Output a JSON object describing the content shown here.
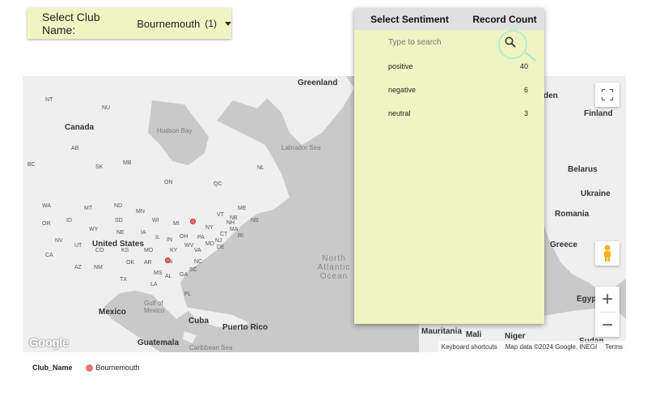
{
  "club_select": {
    "label": "Select Club Name:",
    "value": "Bournemouth",
    "count": "(1)"
  },
  "sentiment_panel": {
    "col_sentiment": "Select Sentiment",
    "col_count": "Record Count",
    "search_placeholder": "Type to search",
    "rows": [
      {
        "sentiment": "positive",
        "count": "40"
      },
      {
        "sentiment": "negative",
        "count": "6"
      },
      {
        "sentiment": "neutral",
        "count": "3"
      }
    ]
  },
  "map": {
    "labels": {
      "greenland": "Greenland",
      "canada": "Canada",
      "hudson_bay": "Hudson Bay",
      "labrador_sea": "Labrador Sea",
      "united_states": "United States",
      "mexico": "Mexico",
      "cuba": "Cuba",
      "puerto_rico": "Puerto Rico",
      "guatemala": "Guatemala",
      "gulf_of_mexico": "Gulf of Mexico",
      "caribbean_sea": "Caribbean Sea",
      "north_atlantic_ocean": "North Atlantic Ocean",
      "finland": "Finland",
      "belarus": "Belarus",
      "ukraine": "Ukraine",
      "romania": "Romania",
      "greece": "Greece",
      "egypt": "Egyp",
      "sudan": "Sudan",
      "mauritania": "Mauritania",
      "mali": "Mali",
      "niger": "Niger",
      "den": "den",
      "nt": "NT",
      "nu": "NU",
      "bc": "BC",
      "ab": "AB",
      "sk": "SK",
      "mb": "MB",
      "on": "ON",
      "qc": "QC",
      "nl": "NL",
      "wa": "WA",
      "mt": "MT",
      "nd": "ND",
      "mn": "MN",
      "or": "OR",
      "id": "ID",
      "wy": "WY",
      "sd": "SD",
      "wi": "WI",
      "mi": "MI",
      "ne": "NE",
      "ia": "IA",
      "nv": "NV",
      "ut": "UT",
      "co": "CO",
      "ks": "KS",
      "mo": "MO",
      "il": "IL",
      "in": "IN",
      "oh": "OH",
      "pa": "PA",
      "ny": "NY",
      "ca": "CA",
      "az": "AZ",
      "nm": "NM",
      "ok": "OK",
      "ar": "AR",
      "tn": "TN",
      "nc": "NC",
      "tx": "TX",
      "ms": "MS",
      "al": "AL",
      "ga": "GA",
      "la": "LA",
      "fl": "FL",
      "va": "VA",
      "wv": "WV",
      "ky": "KY",
      "sc": "SC",
      "nb": "NB",
      "ns": "NS",
      "me": "ME",
      "vt": "VT",
      "nh": "NH",
      "ma": "MA",
      "ct": "CT",
      "nj": "NJ",
      "md": "MD",
      "de": "DE",
      "ri": "RI"
    },
    "google_logo": "Google",
    "attribution": {
      "shortcuts": "Keyboard shortcuts",
      "data": "Map data ©2024 Google, INEGI",
      "terms": "Terms"
    },
    "fullscreen_icon": "fullscreen-icon",
    "pegman_icon": "pegman-icon",
    "zoom_in": "+",
    "zoom_out": "−"
  },
  "legend": {
    "title": "Club_Name",
    "item": "Bournemouth",
    "color": "#e57373"
  }
}
